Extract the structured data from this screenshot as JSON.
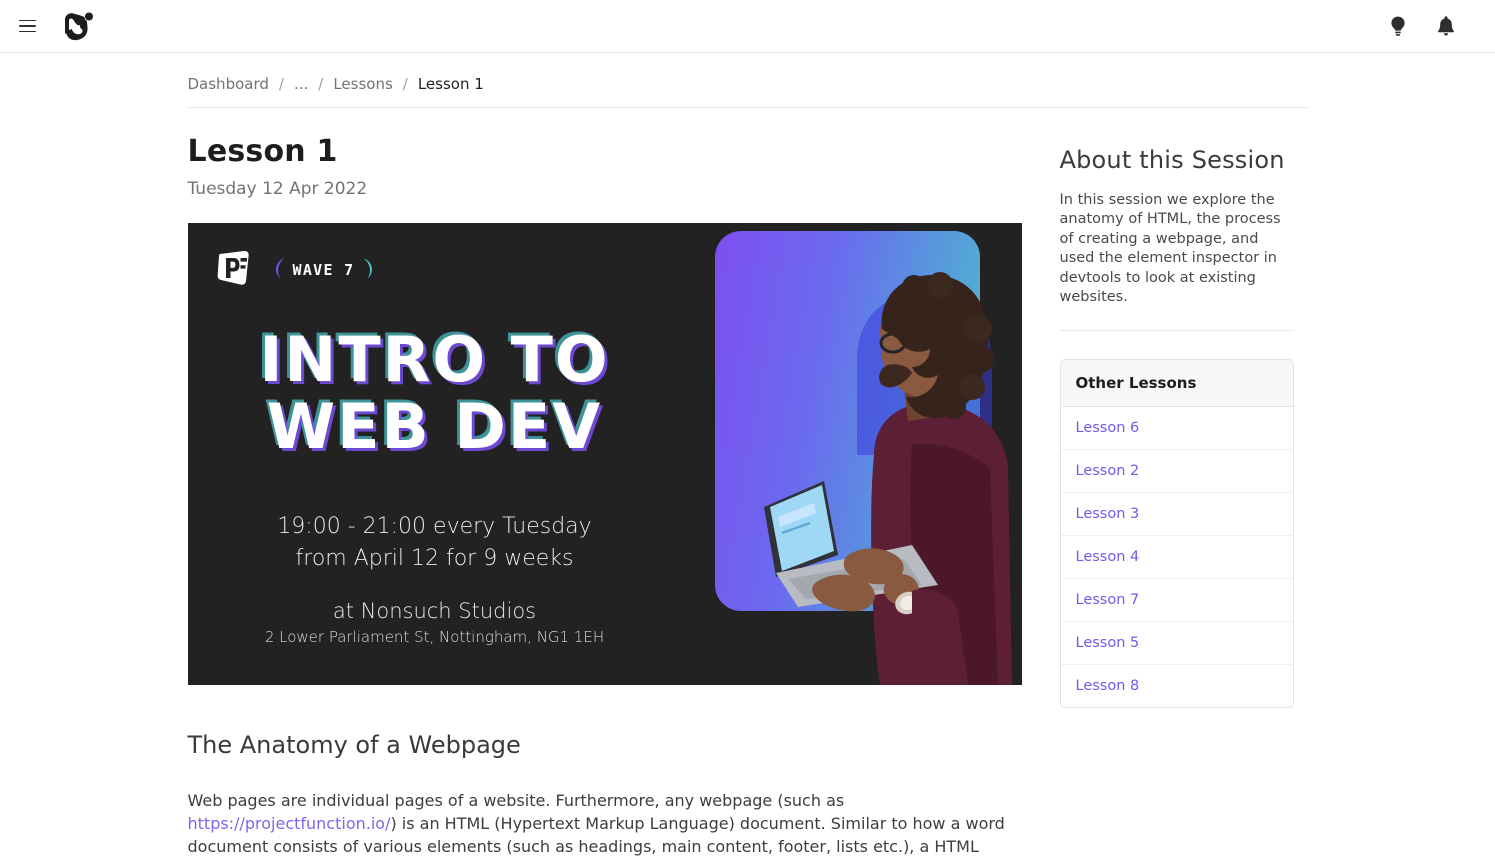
{
  "topbar": {
    "menu_icon": "hamburger-menu-icon",
    "logo_icon": "brand-logo-icon",
    "actions": [
      {
        "icon": "lightbulb-icon",
        "label": "Ideas"
      },
      {
        "icon": "bell-icon",
        "label": "Notifications"
      }
    ]
  },
  "breadcrumb": {
    "items": [
      {
        "label": "Dashboard",
        "current": false
      },
      {
        "label": "...",
        "current": false
      },
      {
        "label": "Lessons",
        "current": false
      },
      {
        "label": "Lesson 1",
        "current": true
      }
    ],
    "separator": "/"
  },
  "lesson": {
    "title": "Lesson 1",
    "date": "Tuesday 12 Apr 2022"
  },
  "hero": {
    "logo_text": "PF",
    "wave_badge": "WAVE 7",
    "title_line1": "INTRO TO",
    "title_line2": "WEB DEV",
    "time_line": "19:00 - 21:00 every Tuesday",
    "dates_line": "from April 12 for 9 weeks",
    "venue": "at Nonsuch Studios",
    "address": "2 Lower Parliament St, Nottingham, NG1 1EH",
    "photo_alt": "person-typing-on-laptop",
    "background_color": "#222222",
    "gradient_start": "#7d4ff0",
    "gradient_end": "#4cc3c9"
  },
  "article": {
    "heading": "The Anatomy of a Webpage",
    "paragraph_before_link": "Web pages are individual pages of a website. Furthermore, any webpage (such as ",
    "link_text": "https://projectfunction.io/",
    "paragraph_after_link": ") is an HTML (Hypertext Markup Language) document. Similar to how a word document consists of various elements (such as headings, main content, footer, lists etc.), a HTML"
  },
  "sidebar": {
    "about_heading": "About this Session",
    "about_text": "In this session we explore the anatomy of HTML, the process of creating a webpage, and used the element inspector in devtools to look at existing websites.",
    "other_lessons_heading": "Other Lessons",
    "other_lessons": [
      {
        "label": "Lesson 6"
      },
      {
        "label": "Lesson 2"
      },
      {
        "label": "Lesson 3"
      },
      {
        "label": "Lesson 4"
      },
      {
        "label": "Lesson 7"
      },
      {
        "label": "Lesson 5"
      },
      {
        "label": "Lesson 8"
      }
    ],
    "link_color": "#6f5ce8"
  }
}
